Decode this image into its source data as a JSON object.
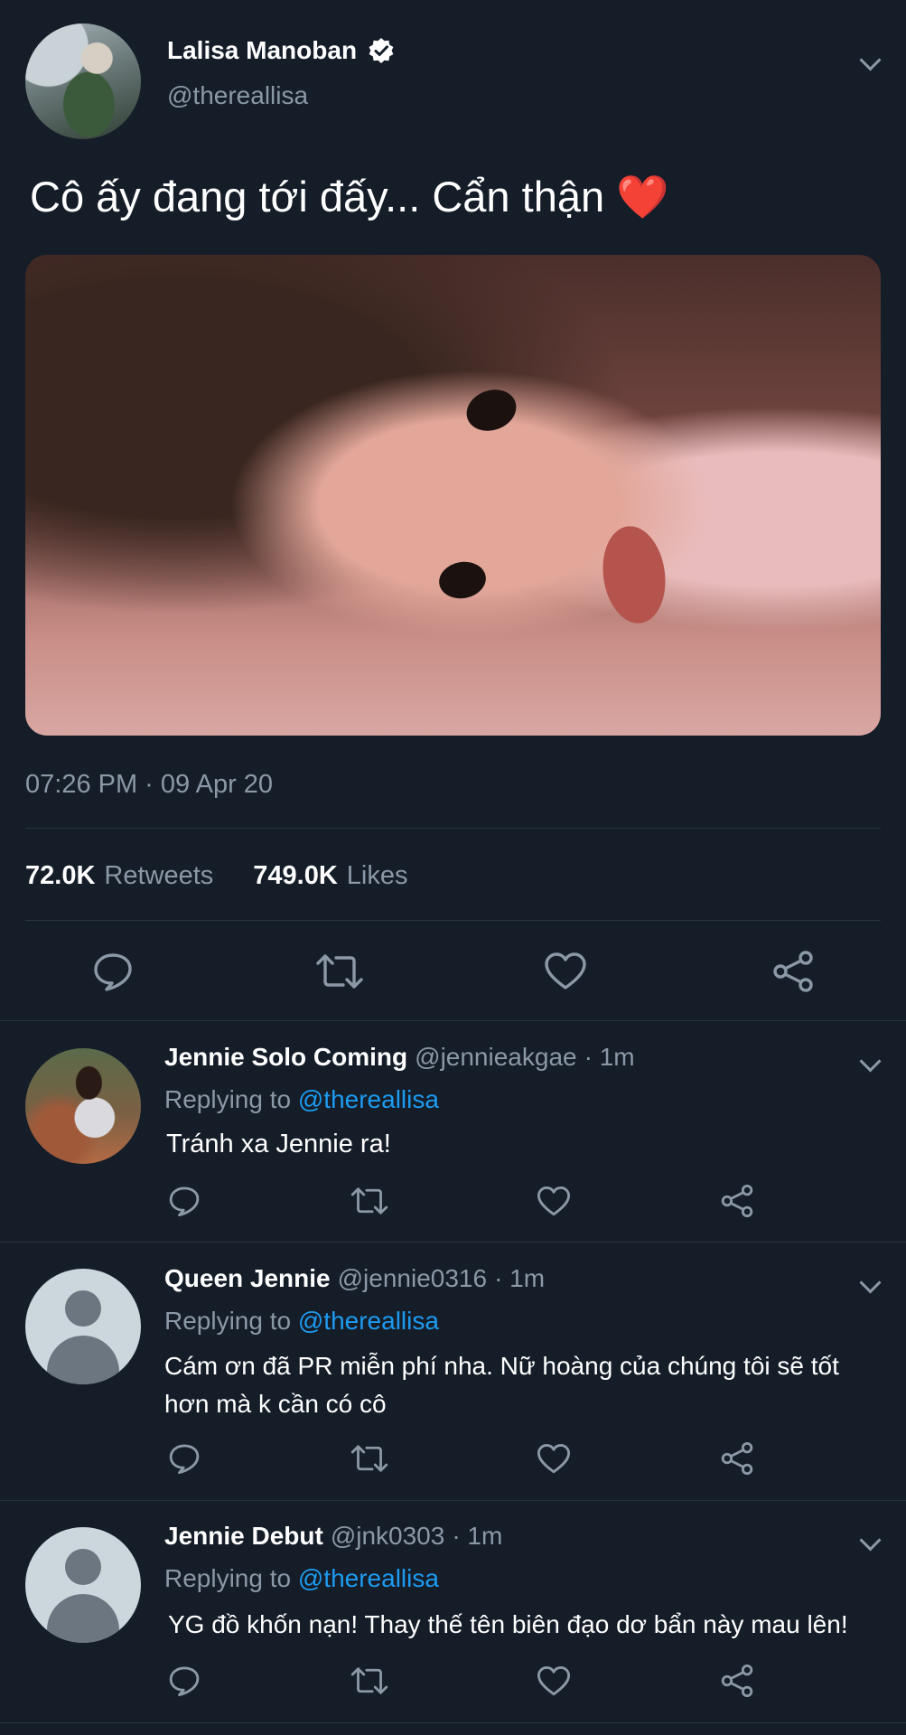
{
  "tweet": {
    "author_name": "Lalisa Manoban",
    "author_handle": "@thereallisa",
    "verified": true,
    "text": "Cô ấy đang tới đấy... Cẩn thận ❤️",
    "time": "07:26 PM · 09 Apr 20",
    "retweets_count": "72.0K",
    "retweets_label": "Retweets",
    "likes_count": "749.0K",
    "likes_label": "Likes"
  },
  "icons": {
    "reply": "reply-bubble-icon",
    "retweet": "retweet-icon",
    "like": "heart-icon",
    "share": "share-icon",
    "menu": "chevron-down-icon",
    "verified": "verified-badge-icon"
  },
  "replies": [
    {
      "name": "Jennie Solo Coming",
      "handle": "@jennieakgae",
      "time": "· 1m",
      "replying_prefix": "Replying to",
      "replying_to": "@thereallisa",
      "text": "Tránh xa Jennie ra!"
    },
    {
      "name": "Queen Jennie",
      "handle": "@jennie0316",
      "time": "· 1m",
      "replying_prefix": "Replying to",
      "replying_to": "@thereallisa",
      "text_line1": "Cám ơn đã PR miễn phí nha. Nữ hoàng của chúng tôi sẽ tốt",
      "text_line2": "hơn mà k cần có cô"
    },
    {
      "name": "Jennie Debut",
      "handle": "@jnk0303",
      "time": "· 1m",
      "replying_prefix": "Replying to",
      "replying_to": "@thereallisa",
      "text": "YG đồ khốn nạn! Thay thế tên biên đạo dơ bẩn này mau lên!"
    }
  ],
  "colors": {
    "background": "#151d29",
    "text": "#ffffff",
    "muted": "#8b98a5",
    "link": "#1d9bf0",
    "heart": "#e0245e"
  }
}
